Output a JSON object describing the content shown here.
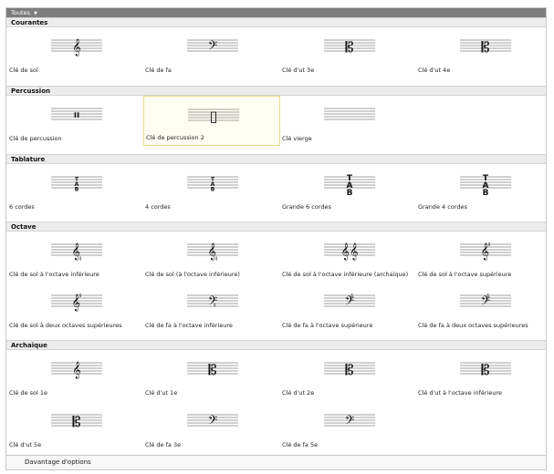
{
  "filter": {
    "label": "Toutes",
    "caret": "▼"
  },
  "sections": [
    {
      "title": "Courantes",
      "items": [
        {
          "label": "Clé de sol",
          "icon": "treble-clef-icon",
          "glyph": "𝄞"
        },
        {
          "label": "Clé de fa",
          "icon": "bass-clef-icon",
          "glyph": "𝄢"
        },
        {
          "label": "Clé d'ut 3e",
          "icon": "alto-clef-icon",
          "glyph": "𝄡"
        },
        {
          "label": "Clé d'ut 4e",
          "icon": "tenor-clef-icon",
          "glyph": "𝄡"
        }
      ]
    },
    {
      "title": "Percussion",
      "items": [
        {
          "label": "Clé de percussion",
          "icon": "percussion-clef-icon",
          "glyph": "𝄥"
        },
        {
          "label": "Clé de percussion 2",
          "icon": "percussion-clef-2-icon",
          "glyph": "▯",
          "selected": true
        },
        {
          "label": "Clé vierge",
          "icon": "blank-clef-icon",
          "glyph": ""
        }
      ]
    },
    {
      "title": "Tablature",
      "items": [
        {
          "label": "6 cordes",
          "icon": "tab-6-strings-icon",
          "glyph": "TAB"
        },
        {
          "label": "4 cordes",
          "icon": "tab-4-strings-icon",
          "glyph": "TAB"
        },
        {
          "label": "Grande 6 cordes",
          "icon": "tab-large-6-strings-icon",
          "glyph": "TAB"
        },
        {
          "label": "Grande 4 cordes",
          "icon": "tab-large-4-strings-icon",
          "glyph": "TAB"
        }
      ]
    },
    {
      "title": "Octave",
      "items": [
        {
          "label": "Clé de sol à l'octave inférieure",
          "icon": "treble-8vb-clef-icon",
          "glyph": "𝄠"
        },
        {
          "label": "Clé de sol (à l'octave inférieure)",
          "icon": "treble-8vb-paren-clef-icon",
          "glyph": "𝄠"
        },
        {
          "label": "Clé de sol à l'octave inférieure (archaïque)",
          "icon": "double-treble-clef-icon",
          "glyph": "𝄞𝄞"
        },
        {
          "label": "Clé de sol à l'octave supérieure",
          "icon": "treble-8va-clef-icon",
          "glyph": "𝄟"
        },
        {
          "label": "Clé de sol à deux octaves supérieures",
          "icon": "treble-15ma-clef-icon",
          "glyph": "𝄟"
        },
        {
          "label": "Clé de fa à l'octave inférieure",
          "icon": "bass-8vb-clef-icon",
          "glyph": "𝄤"
        },
        {
          "label": "Clé de fa à l'octave supérieure",
          "icon": "bass-8va-clef-icon",
          "glyph": "𝄣"
        },
        {
          "label": "Clé de fa à deux octaves supérieures",
          "icon": "bass-15ma-clef-icon",
          "glyph": "𝄣"
        }
      ]
    },
    {
      "title": "Archaïque",
      "items": [
        {
          "label": "Clé de sol 1e",
          "icon": "french-violin-clef-icon",
          "glyph": "𝄞"
        },
        {
          "label": "Clé d'ut 1e",
          "icon": "soprano-clef-icon",
          "glyph": "𝄡"
        },
        {
          "label": "Clé d'ut 2e",
          "icon": "mezzo-soprano-clef-icon",
          "glyph": "𝄡"
        },
        {
          "label": "Clé d'ut à l'octave inférieure",
          "icon": "c-clef-8vb-icon",
          "glyph": "𝄡"
        },
        {
          "label": "Clé d'ut 5e",
          "icon": "baritone-c-clef-icon",
          "glyph": "𝄡"
        },
        {
          "label": "Clé de fa 3e",
          "icon": "baritone-f-clef-icon",
          "glyph": "𝄢"
        },
        {
          "label": "Clé de fa 5e",
          "icon": "subbass-clef-icon",
          "glyph": "𝄢"
        }
      ]
    }
  ],
  "footer": {
    "label": "Davantage d'options"
  },
  "colors": {
    "topbar": "#7d7d7d",
    "selection_border": "#f0d98a"
  }
}
